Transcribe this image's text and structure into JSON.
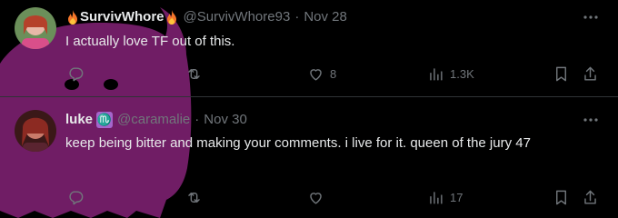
{
  "tweets": [
    {
      "display_name": "SurvivWhore",
      "handle": "@SurvivWhore93",
      "date": "Nov 28",
      "text": "I actually love TF out of this.",
      "reply_count": "",
      "retweet_count": "",
      "like_count": "8",
      "view_count": "1.3K"
    },
    {
      "display_name": "luke",
      "name_badge": "♏",
      "handle": "@caramalie",
      "date": "Nov 30",
      "text": "keep being bitter and making your comments. i live for it. queen of the jury 47",
      "reply_count": "",
      "retweet_count": "",
      "like_count": "",
      "view_count": "17"
    }
  ],
  "separator": "·",
  "colors": {
    "background": "#000000",
    "text": "#e7e9ea",
    "muted": "#71767b",
    "divider": "#2f3336",
    "watermark": "#7a1f6e",
    "zodiac_badge": "#a566cc"
  },
  "icons": {
    "reply": "reply-icon",
    "retweet": "retweet-icon",
    "like": "heart-icon",
    "views": "views-icon",
    "bookmark": "bookmark-icon",
    "share": "share-icon",
    "more": "more-icon"
  }
}
